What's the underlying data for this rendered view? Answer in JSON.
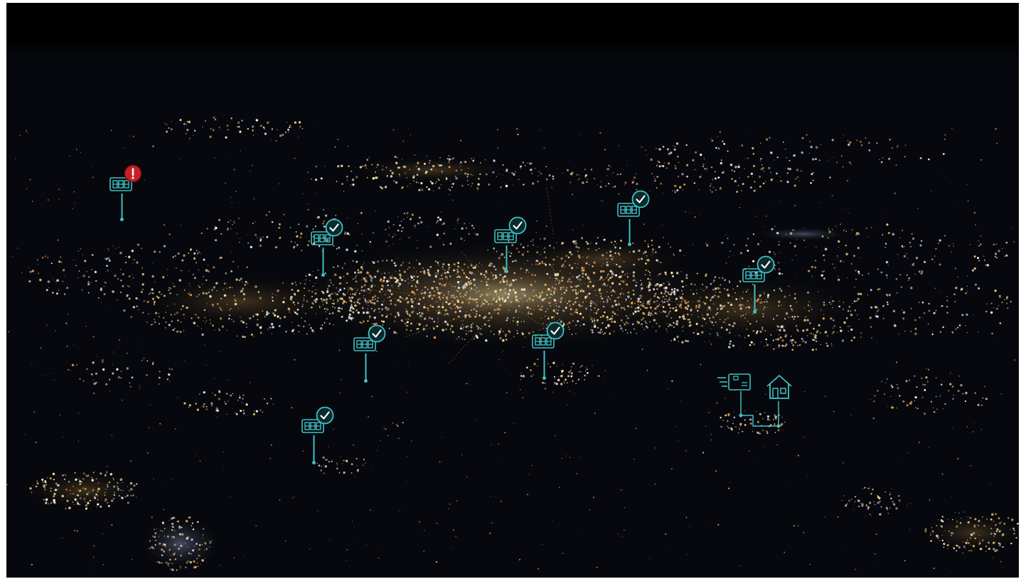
{
  "colors": {
    "accent": "#3fc1c4",
    "alert": "#c8202a",
    "background": "#05070b"
  },
  "markers": [
    {
      "id": "facility-1",
      "icon": "server-rack-icon",
      "status": "alert",
      "status_icon": "exclamation-icon"
    },
    {
      "id": "facility-2",
      "icon": "server-rack-icon",
      "status": "ok",
      "status_icon": "checkmark-icon"
    },
    {
      "id": "facility-3",
      "icon": "server-rack-icon",
      "status": "ok",
      "status_icon": "checkmark-icon"
    },
    {
      "id": "facility-4",
      "icon": "server-rack-icon",
      "status": "ok",
      "status_icon": "checkmark-icon"
    },
    {
      "id": "facility-5",
      "icon": "server-rack-icon",
      "status": "ok",
      "status_icon": "checkmark-icon"
    },
    {
      "id": "facility-6",
      "icon": "server-rack-icon",
      "status": "ok",
      "status_icon": "checkmark-icon"
    },
    {
      "id": "facility-7",
      "icon": "server-rack-icon",
      "status": "ok",
      "status_icon": "checkmark-icon"
    },
    {
      "id": "facility-8",
      "icon": "server-rack-icon",
      "status": "ok",
      "status_icon": "checkmark-icon"
    }
  ],
  "route": {
    "from_icon": "delivery-package-icon",
    "to_icon": "house-icon"
  }
}
